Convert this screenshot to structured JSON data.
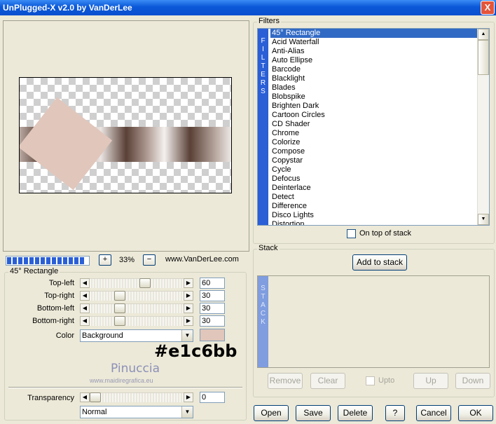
{
  "window": {
    "title": "UnPlugged-X v2.0 by VanDerLee",
    "close_glyph": "X"
  },
  "preview": {
    "progress_segments": 14
  },
  "zoom": {
    "plus": "+",
    "value": "33%",
    "minus": "−",
    "website": "www.VanDerLee.com"
  },
  "params": {
    "group_title": "45° Rectangle",
    "rows": [
      {
        "label": "Top-left",
        "value": "60",
        "level": 0.6
      },
      {
        "label": "Top-right",
        "value": "30",
        "level": 0.3
      },
      {
        "label": "Bottom-left",
        "value": "30",
        "level": 0.3
      },
      {
        "label": "Bottom-right",
        "value": "30",
        "level": 0.3
      }
    ],
    "color_label": "Color",
    "color_value": "Background",
    "swatch_color": "#e1c6bb",
    "hex_annotation": "#e1c6bb",
    "watermark_name": "Pinuccia",
    "watermark_url": "www.maidiregrafica.eu",
    "transparency_label": "Transparency",
    "transparency_value": "0",
    "transparency_level": 0.0,
    "blend_mode": "Normal"
  },
  "filters": {
    "group_title": "Filters",
    "strip_letters": [
      "F",
      "I",
      "L",
      "T",
      "E",
      "R",
      "S"
    ],
    "items": [
      "45° Rectangle",
      "Acid Waterfall",
      "Anti-Alias",
      "Auto Ellipse",
      "Barcode",
      "Blacklight",
      "Blades",
      "Blobspike",
      "Brighten Dark",
      "Cartoon Circles",
      "CD Shader",
      "Chrome",
      "Colorize",
      "Compose",
      "Copystar",
      "Cycle",
      "Defocus",
      "Deinterlace",
      "Detect",
      "Difference",
      "Disco Lights",
      "Distortion"
    ],
    "selected_index": 0,
    "on_top_label": "On top of stack"
  },
  "stack": {
    "group_title": "Stack",
    "add_label": "Add to stack",
    "strip_letters": [
      "S",
      "T",
      "A",
      "C",
      "K"
    ],
    "remove_label": "Remove",
    "clear_label": "Clear",
    "upto_label": "Upto",
    "up_label": "Up",
    "down_label": "Down"
  },
  "footer": {
    "open": "Open",
    "save": "Save",
    "delete": "Delete",
    "help": "?",
    "cancel": "Cancel",
    "ok": "OK"
  }
}
